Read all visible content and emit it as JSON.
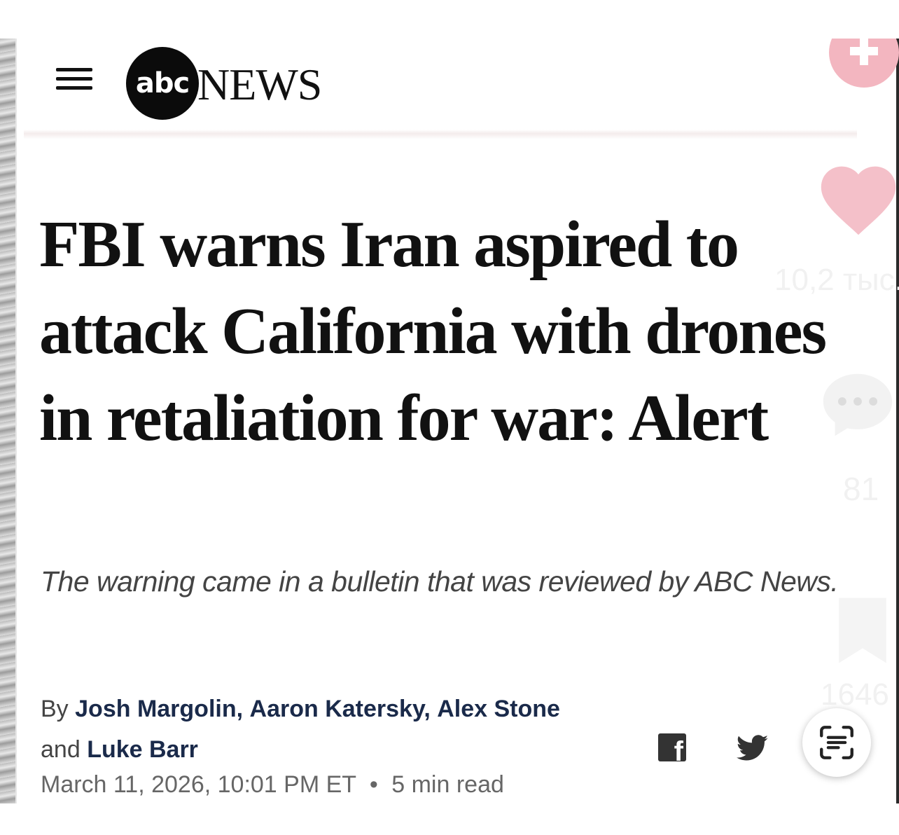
{
  "header": {
    "logo": {
      "circle_text": "abc",
      "word": "NEWS"
    }
  },
  "article": {
    "headline": "FBI warns Iran aspired to attack California with drones in retaliation for war: Alert",
    "subhead": "The warning came in a bulletin that was reviewed by ABC News.",
    "byline": {
      "prefix": "By",
      "authors": [
        "Josh Margolin",
        "Aaron Katersky",
        "Alex Stone",
        "Luke Barr"
      ],
      "separator": ",",
      "conjunction": "and"
    },
    "date": "March 11, 2026, 10:01 PM ET",
    "dot": "•",
    "read_time": "5 min read"
  },
  "share": {
    "facebook_glyph": "f"
  },
  "overlay": {
    "like_count": "10,2 тыс.",
    "comment_count": "81",
    "save_count": "1646"
  },
  "icons": {
    "menu": "hamburger-icon",
    "facebook": "facebook-icon",
    "twitter": "twitter-icon",
    "plus": "plus-icon",
    "like": "heart-icon",
    "comment": "comment-icon",
    "save": "bookmark-icon",
    "scan": "scan-text-icon"
  },
  "colors": {
    "text": "#111111",
    "author": "#1a2a4a",
    "muted": "#666666",
    "overlay_pink": "#f3b6c0"
  }
}
